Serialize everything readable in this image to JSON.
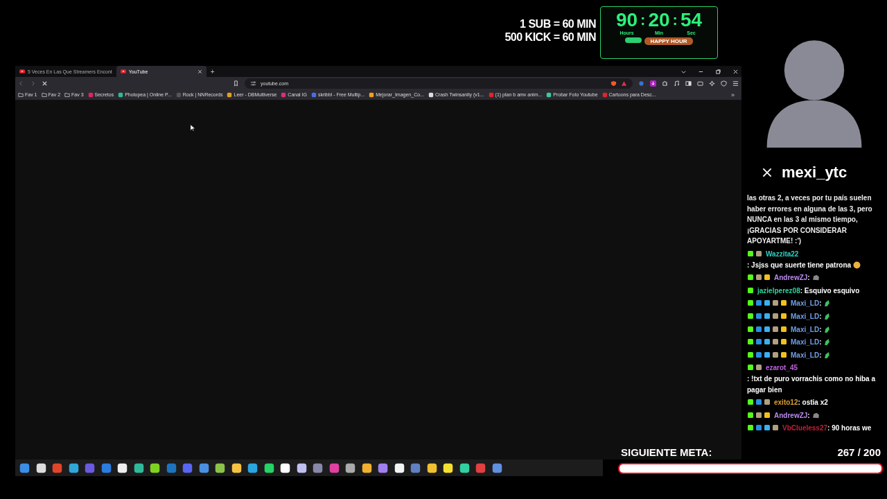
{
  "overlay": {
    "rate_lines": [
      "1 SUB = 60 MIN",
      "500 KICK = 60 MIN"
    ],
    "timer": {
      "units": [
        {
          "value": "90",
          "label": "Hours"
        },
        {
          "value": "20",
          "label": "Min"
        },
        {
          "value": "54",
          "label": "Sec"
        }
      ],
      "separator": ":",
      "happy_hour": "HAPPY HOUR"
    }
  },
  "browser": {
    "tabs": [
      {
        "title": "5 Veces En Las Que Streamers Encont",
        "selected": false,
        "color": "#e0242f"
      },
      {
        "title": "YouTube",
        "selected": true,
        "color": "#e0242f"
      }
    ],
    "new_tab": "+",
    "address": "youtube.com",
    "loading": true,
    "bookmarks": [
      {
        "label": "Fav 1",
        "kind": "folder"
      },
      {
        "label": "Fav 2",
        "kind": "folder"
      },
      {
        "label": "Fav 3",
        "kind": "folder"
      },
      {
        "label": "Secretos",
        "kind": "site",
        "color": "#e0245e"
      },
      {
        "label": "Photopea | Online P...",
        "kind": "site",
        "color": "#2fb99b"
      },
      {
        "label": "Rock | NNRecords",
        "kind": "site",
        "color": "#555555"
      },
      {
        "label": "Leer - DBMultiverse",
        "kind": "site",
        "color": "#e0a020"
      },
      {
        "label": "Canal IG",
        "kind": "site",
        "color": "#d6307a"
      },
      {
        "label": "skribbl - Free Multip...",
        "kind": "site",
        "color": "#4a6ee0"
      },
      {
        "label": "Mejorar_Imagen_Co...",
        "kind": "site",
        "color": "#f0a020"
      },
      {
        "label": "Crash Twinsanity (v1...",
        "kind": "site",
        "color": "#dddddd"
      },
      {
        "label": "(1) plan b amv anim...",
        "kind": "site",
        "color": "#e0242f"
      },
      {
        "label": "Probar Foto Youtube",
        "kind": "site",
        "color": "#3ec99a"
      },
      {
        "label": "Cartoons para Desc...",
        "kind": "site",
        "color": "#e0242f"
      }
    ],
    "more": "»"
  },
  "taskbar": [
    {
      "color": "#3a8ee6"
    },
    {
      "color": "#dddddd"
    },
    {
      "color": "#e0452a"
    },
    {
      "color": "#2fa8d8"
    },
    {
      "color": "#6a5ae0"
    },
    {
      "color": "#2a7de0"
    },
    {
      "color": "#eeeeee"
    },
    {
      "color": "#2fb99b"
    },
    {
      "color": "#7ed321"
    },
    {
      "color": "#1e73be"
    },
    {
      "color": "#5865f2"
    },
    {
      "color": "#4a90e2"
    },
    {
      "color": "#8bc34a"
    },
    {
      "color": "#f5c242"
    },
    {
      "color": "#2aa5e0"
    },
    {
      "color": "#25d366"
    },
    {
      "color": "#ffffff"
    },
    {
      "color": "#c0c0f0"
    },
    {
      "color": "#8888aa"
    },
    {
      "color": "#e040a0"
    },
    {
      "color": "#aaaaaa"
    },
    {
      "color": "#f0b030"
    },
    {
      "color": "#a080f0"
    },
    {
      "color": "#f4f4f4"
    },
    {
      "color": "#6080c0"
    },
    {
      "color": "#f0c030"
    },
    {
      "color": "#f5e030"
    },
    {
      "color": "#30d0a0"
    },
    {
      "color": "#e04040"
    },
    {
      "color": "#6090e0"
    }
  ],
  "channel": {
    "name": "mexi_ytc"
  },
  "chat": [
    {
      "kind": "notice",
      "text": "las otras 2, a veces por tu país suelen haber errores en alguna de las 3, pero NUNCA en las 3 al mismo tiempo, ¡GRACIAS POR CONSIDERAR APOYARTME! :')"
    },
    {
      "kind": "message",
      "badges": [
        {
          "kind": "kick"
        },
        {
          "kind": "mouse"
        }
      ],
      "user": "Wazzita22",
      "color": "#2ed3c6",
      "text": ": Jsjss que suerte tiene patrona",
      "emote": {
        "kind": "face"
      }
    },
    {
      "kind": "message",
      "badges": [
        {
          "kind": "kick"
        },
        {
          "kind": "mouse"
        },
        {
          "kind": "crown"
        }
      ],
      "user": "AndrewZJ",
      "color": "#b98cf0",
      "text": ":",
      "emote": {
        "kind": "rock"
      }
    },
    {
      "kind": "message",
      "badges": [
        {
          "kind": "kick"
        }
      ],
      "user": "jazielperez08",
      "color": "#2ed3a0",
      "text": ": Esquivo esquivo"
    },
    {
      "kind": "message",
      "badges": [
        {
          "kind": "kick"
        },
        {
          "kind": "sword"
        },
        {
          "kind": "cube"
        },
        {
          "kind": "mouse"
        },
        {
          "kind": "crown"
        }
      ],
      "user": "Maxi_LD",
      "color": "#6fa0e8",
      "text": ":",
      "emote": {
        "kind": "leaf"
      }
    },
    {
      "kind": "message",
      "badges": [
        {
          "kind": "kick"
        },
        {
          "kind": "sword"
        },
        {
          "kind": "cube"
        },
        {
          "kind": "mouse"
        },
        {
          "kind": "crown"
        }
      ],
      "user": "Maxi_LD",
      "color": "#6fa0e8",
      "text": ":",
      "emote": {
        "kind": "leaf"
      }
    },
    {
      "kind": "message",
      "badges": [
        {
          "kind": "kick"
        },
        {
          "kind": "sword"
        },
        {
          "kind": "cube"
        },
        {
          "kind": "mouse"
        },
        {
          "kind": "crown"
        }
      ],
      "user": "Maxi_LD",
      "color": "#6fa0e8",
      "text": ":",
      "emote": {
        "kind": "leaf"
      }
    },
    {
      "kind": "message",
      "badges": [
        {
          "kind": "kick"
        },
        {
          "kind": "sword"
        },
        {
          "kind": "cube"
        },
        {
          "kind": "mouse"
        },
        {
          "kind": "crown"
        }
      ],
      "user": "Maxi_LD",
      "color": "#6fa0e8",
      "text": ":",
      "emote": {
        "kind": "leaf"
      }
    },
    {
      "kind": "message",
      "badges": [
        {
          "kind": "kick"
        },
        {
          "kind": "sword"
        },
        {
          "kind": "cube"
        },
        {
          "kind": "mouse"
        },
        {
          "kind": "crown"
        }
      ],
      "user": "Maxi_LD",
      "color": "#6fa0e8",
      "text": ":",
      "emote": {
        "kind": "leaf"
      }
    },
    {
      "kind": "message",
      "badges": [
        {
          "kind": "kick"
        },
        {
          "kind": "mouse"
        }
      ],
      "user": "ezarot_45",
      "color": "#c060e0",
      "text": ": !txt de puro vorrachis como no hiba a pagar bien"
    },
    {
      "kind": "message",
      "badges": [
        {
          "kind": "kick"
        },
        {
          "kind": "sword"
        },
        {
          "kind": "mouse"
        }
      ],
      "user": "exito12",
      "color": "#e0a030",
      "text": ": ostia x2"
    },
    {
      "kind": "message",
      "badges": [
        {
          "kind": "kick"
        },
        {
          "kind": "mouse"
        },
        {
          "kind": "crown"
        }
      ],
      "user": "AndrewZJ",
      "color": "#b98cf0",
      "text": ":",
      "emote": {
        "kind": "rock"
      }
    },
    {
      "kind": "message",
      "badges": [
        {
          "kind": "kick"
        },
        {
          "kind": "sword"
        },
        {
          "kind": "cube"
        },
        {
          "kind": "mouse"
        }
      ],
      "user": "VbClueless27",
      "color": "#c0203a",
      "text": ": 90 horas we"
    }
  ],
  "goal": {
    "label": "SIGUIENTE META:",
    "count": "267 / 200",
    "level": 1
  }
}
